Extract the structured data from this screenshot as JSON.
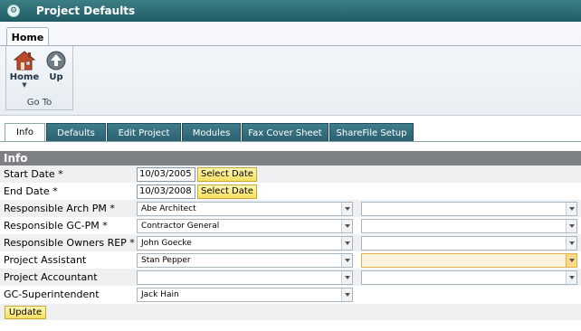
{
  "window": {
    "title": "Project Defaults"
  },
  "ribbon": {
    "tab": "Home",
    "buttons": [
      {
        "label": "Home",
        "icon": "house-icon"
      },
      {
        "label": "Up",
        "icon": "up-arrow-icon"
      }
    ],
    "group_label": "Go To"
  },
  "tabs": [
    {
      "label": "Info",
      "active": true
    },
    {
      "label": "Defaults",
      "active": false
    },
    {
      "label": "Edit Project",
      "active": false
    },
    {
      "label": "Modules",
      "active": false
    },
    {
      "label": "Fax Cover Sheet",
      "active": false
    },
    {
      "label": "ShareFile Setup",
      "active": false
    }
  ],
  "section": {
    "title": "Info"
  },
  "form": {
    "start_date": {
      "label": "Start Date  *",
      "value": "10/03/2005",
      "button": "Select Date"
    },
    "end_date": {
      "label": "End Date  *",
      "value": "10/03/2008",
      "button": "Select Date"
    },
    "rows": [
      {
        "label": "Responsible Arch PM *",
        "value1": "Abe Architect",
        "value2": ""
      },
      {
        "label": "Responsible GC-PM *",
        "value1": "Contractor General",
        "value2": ""
      },
      {
        "label": "Responsible Owners REP *",
        "value1": "John Goecke",
        "value2": ""
      },
      {
        "label": "Project Assistant",
        "value1": "Stan Pepper",
        "value2": ""
      },
      {
        "label": "Project Accountant",
        "value1": "",
        "value2": ""
      },
      {
        "label": "GC-Superintendent",
        "value1": "Jack Hain"
      }
    ],
    "update_button": "Update"
  },
  "colors": {
    "titlebar": "#2a6a72",
    "tab_bg": "#2f6b7a",
    "section_header": "#7d8184",
    "yellow_button": "#f7e060"
  }
}
